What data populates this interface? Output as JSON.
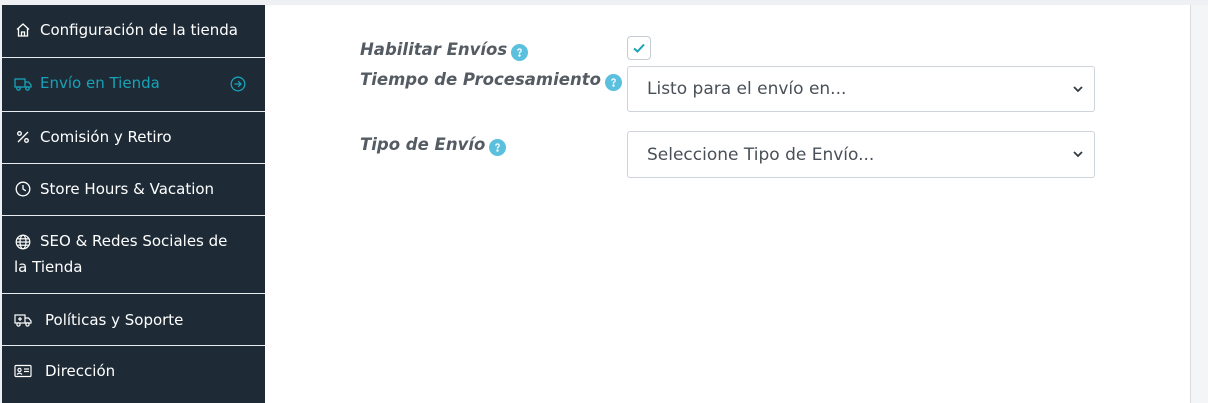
{
  "sidebar": {
    "items": [
      {
        "label": "Configuración de la tienda",
        "icon": "home-icon"
      },
      {
        "label": "Envío en Tienda",
        "icon": "truck-icon",
        "active": true,
        "arrow_icon": "arrow-circle-right-icon"
      },
      {
        "label": "Comisión y Retiro",
        "icon": "percent-icon"
      },
      {
        "label": "Store Hours & Vacation",
        "icon": "clock-icon"
      },
      {
        "label": "SEO & Redes Sociales de la Tienda",
        "icon": "globe-icon"
      },
      {
        "label": "Políticas y Soporte",
        "icon": "ambulance-icon"
      },
      {
        "label": "Dirección",
        "icon": "id-card-icon"
      }
    ]
  },
  "form": {
    "enable_shipping": {
      "label": "Habilitar Envíos",
      "checked": true,
      "help_icon": "help-icon"
    },
    "processing_time": {
      "label": "Tiempo de Procesamiento",
      "value": "Listo para el envío en...",
      "help_icon": "help-icon"
    },
    "shipping_type": {
      "label": "Tipo de Envío",
      "value": "Seleccione Tipo de Envío...",
      "help_icon": "help-icon"
    }
  },
  "colors": {
    "sidebar_bg": "#1e2b36",
    "accent": "#17a2b8",
    "help": "#5bc0de",
    "label": "#545b62"
  }
}
